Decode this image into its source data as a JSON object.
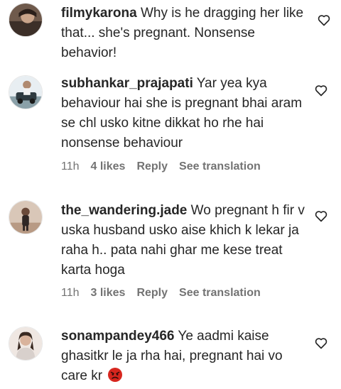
{
  "comments": [
    {
      "username": "filmykarona",
      "text": "Why is he dragging her like that... she's pregnant. Nonsense behavior!",
      "avatar": "avatar-photo",
      "like_icon": "heart-icon"
    },
    {
      "username": "subhankar_prajapati",
      "text": "Yar yea kya behaviour hai she is pregnant bhai aram se chl usko kitne dikkat ho rhe hai nonsense behaviour",
      "time": "11h",
      "likes": "4 likes",
      "reply": "Reply",
      "translate": "See translation",
      "avatar": "avatar-photo",
      "like_icon": "heart-icon"
    },
    {
      "username": "the_wandering.jade",
      "text": "Wo pregnant h fir v uska husband usko aise khich k lekar ja raha h.. pata nahi ghar me kese treat karta hoga",
      "time": "11h",
      "likes": "3 likes",
      "reply": "Reply",
      "translate": "See translation",
      "avatar": "avatar-photo",
      "like_icon": "heart-icon"
    },
    {
      "username": "sonampandey466",
      "text": "Ye aadmi kaise ghasitkr le ja rha hai, pregnant hai vo care kr",
      "emoji": "angry-face-emoji",
      "avatar": "avatar-photo",
      "like_icon": "heart-icon"
    }
  ],
  "colors": {
    "text": "#262626",
    "meta": "#737373",
    "angry_emoji": "#d7261e"
  }
}
